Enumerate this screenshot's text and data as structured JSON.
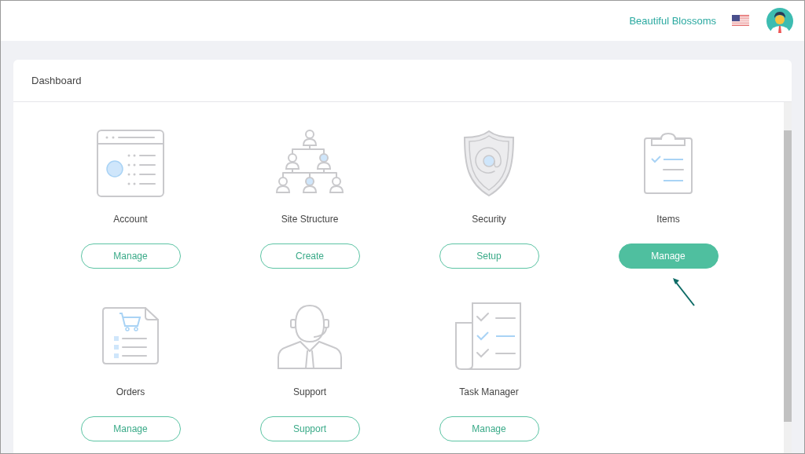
{
  "header": {
    "brand": "Beautiful Blossoms"
  },
  "panel": {
    "title": "Dashboard"
  },
  "tiles": [
    {
      "kind": "account",
      "label": "Account",
      "button": "Manage",
      "selected": false
    },
    {
      "kind": "structure",
      "label": "Site Structure",
      "button": "Create",
      "selected": false
    },
    {
      "kind": "security",
      "label": "Security",
      "button": "Setup",
      "selected": false
    },
    {
      "kind": "items",
      "label": "Items",
      "button": "Manage",
      "selected": true
    },
    {
      "kind": "orders",
      "label": "Orders",
      "button": "Manage",
      "selected": false
    },
    {
      "kind": "support",
      "label": "Support",
      "button": "Support",
      "selected": false
    },
    {
      "kind": "tasks",
      "label": "Task Manager",
      "button": "Manage",
      "selected": false
    }
  ]
}
